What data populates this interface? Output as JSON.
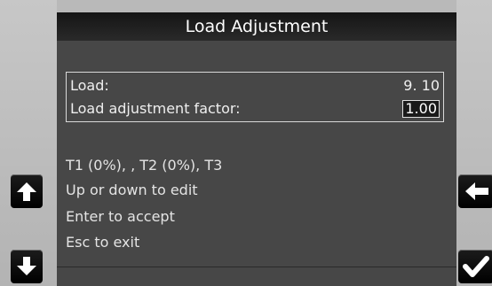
{
  "title": "Load Adjustment",
  "panel": {
    "rows": [
      {
        "label": "Load:",
        "value": "9. 10"
      },
      {
        "label": "Load adjustment factor:",
        "value": "1.00"
      }
    ]
  },
  "messages": [
    "T1 (0%), , T2 (0%), T3",
    "Up or down to edit",
    "Enter to accept",
    "Esc to exit"
  ],
  "buttons": {
    "up": "arrow-up-icon",
    "down": "arrow-down-icon",
    "back": "arrow-left-icon",
    "accept": "checkmark-icon"
  }
}
